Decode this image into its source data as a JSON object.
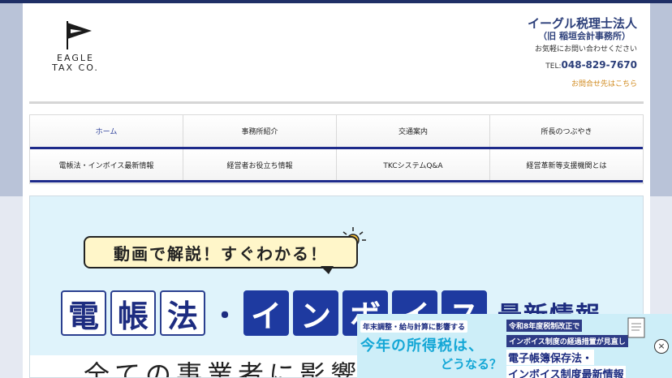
{
  "header": {
    "logo_line1": "EAGLE",
    "logo_line2": "TAX CO.",
    "company_name": "イーグル税理士法人",
    "company_former": "（旧 稲垣会計事務所）",
    "contact_note": "お気軽にお問い合わせください",
    "tel_prefix": "TEL:",
    "tel_number": "048-829-7670",
    "contact_link": "お問合せ先はこちら"
  },
  "nav": {
    "row1": [
      "ホーム",
      "事務所紹介",
      "交通案内",
      "所長のつぶやき"
    ],
    "row2": [
      "電帳法・インボイス最新情報",
      "経営者お役立ち情報",
      "TKCシステムQ&A",
      "経営革新等支援機関とは"
    ]
  },
  "banner": {
    "speech": "動画で解説！すぐわかる！",
    "title_chars": [
      "電",
      "帳",
      "法",
      "イ",
      "ン",
      "ボ",
      "イ",
      "ス"
    ],
    "title_dot": "・",
    "title_suffix": "最新情報",
    "subline": "全ての事業者に影響の"
  },
  "ad": {
    "left_tag": "年末調整・給与計算に影響する",
    "left_big1": "今年の所得税は、",
    "left_big2": "どうなる？",
    "right_tag1": "令和8年度税制改正で",
    "right_tag2": "インボイス制度の経過措置が見直し",
    "right_line1": "電子帳簿保存法・",
    "right_line2": "インボイス制度最新情報",
    "close_symbol": "×"
  },
  "colors": {
    "brand_navy": "#2c3f7a",
    "nav_accent": "#1d2a8a",
    "link_orange": "#d08a1e",
    "banner_bg": "#dff3fb"
  }
}
